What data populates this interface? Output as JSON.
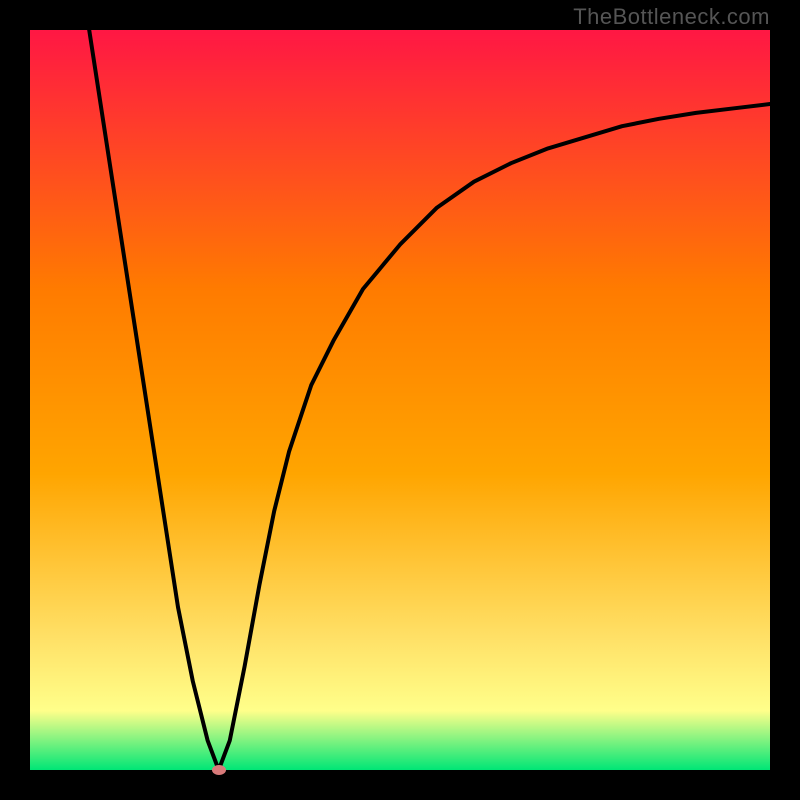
{
  "watermark": "TheBottleneck.com",
  "chart_data": {
    "type": "line",
    "title": "",
    "xlabel": "",
    "ylabel": "",
    "xlim": [
      0,
      100
    ],
    "ylim": [
      0,
      100
    ],
    "grid": false,
    "gradient_background": {
      "top": "#ff1744",
      "mid_upper": "#ffa500",
      "mid": "#ffe066",
      "mid_lower": "#ffff8a",
      "bottom": "#00e676"
    },
    "series": [
      {
        "name": "curve",
        "x": [
          8,
          10,
          12,
          14,
          16,
          18,
          20,
          22,
          24,
          25.5,
          27,
          29,
          31,
          33,
          35,
          38,
          41,
          45,
          50,
          55,
          60,
          65,
          70,
          75,
          80,
          85,
          90,
          95,
          100
        ],
        "y": [
          100,
          87,
          74,
          61,
          48,
          35,
          22,
          12,
          4,
          0,
          4,
          14,
          25,
          35,
          43,
          52,
          58,
          65,
          71,
          76,
          79.5,
          82,
          84,
          85.5,
          87,
          88,
          88.8,
          89.4,
          90
        ]
      }
    ],
    "marker": {
      "x": 25.5,
      "y": 0
    }
  }
}
